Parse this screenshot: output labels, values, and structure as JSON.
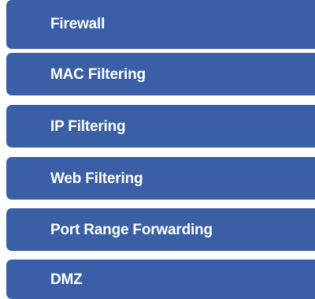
{
  "menu": {
    "items": [
      {
        "label": "Firewall"
      },
      {
        "label": "MAC Filtering"
      },
      {
        "label": "IP Filtering"
      },
      {
        "label": "Web Filtering"
      },
      {
        "label": "Port Range Forwarding"
      },
      {
        "label": "DMZ"
      }
    ],
    "colors": {
      "item_background": "#3a5fa7",
      "item_text": "#ffffff",
      "page_background": "#ffffff"
    }
  }
}
